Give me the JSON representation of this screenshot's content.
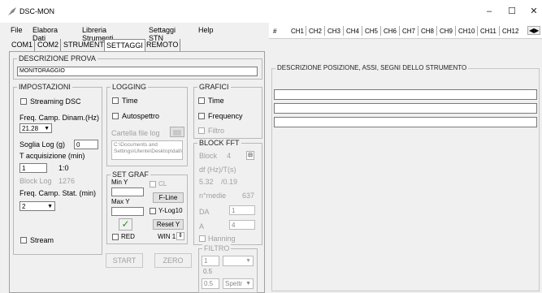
{
  "window": {
    "title": "DSC-MON",
    "minimize": "–",
    "maximize": "☐",
    "close": "✕"
  },
  "menu": [
    "File",
    "Elabora Dati",
    "Libreria Strumenti",
    "Settaggi STN",
    "Help"
  ],
  "tabs": [
    {
      "label": "COM1",
      "active": false
    },
    {
      "label": "COM2",
      "active": false
    },
    {
      "label": "STRUMENTI",
      "active": false
    },
    {
      "label": "SETTAGGI",
      "active": true
    },
    {
      "label": "REMOTO",
      "active": false
    }
  ],
  "descrizione": {
    "legend": "DESCRIZIONE PROVA",
    "value": "MONITORAGGIO"
  },
  "impostazioni": {
    "legend": "IMPOSTAZIONI",
    "streaming_dsc": "Streaming DSC",
    "freq_dinam_label": "Freq. Camp. Dinam.(Hz)",
    "freq_dinam_value": "21.28",
    "soglia_label": "Soglia Log (g)",
    "soglia_value": "0",
    "tacq_label": "T acquisizione (min)",
    "tacq_value": "1",
    "ratio": "1:0",
    "block_log_label": "Block Log",
    "block_log_value": "1276",
    "freq_stat_label": "Freq. Camp. Stat. (min)",
    "freq_stat_value": "2",
    "stream": "Stream"
  },
  "logging": {
    "legend": "LOGGING",
    "time": "Time",
    "autospettro": "Autospettro",
    "cartella_label": "Cartella file log",
    "path": "C:\\Documents and Settings\\Utente\\Desktop\\dati\\"
  },
  "set_graf": {
    "legend": "SET GRAF",
    "min_y": "Min Y",
    "max_y": "Max Y",
    "cl": "CL",
    "f_line": "F-Line",
    "y_log10": "Y-Log10",
    "check_icon": "✓",
    "reset_y": "Reset Y",
    "red": "RED",
    "win": "WIN 1"
  },
  "grafici": {
    "legend": "GRAFICI",
    "time": "Time",
    "frequency": "Frequency",
    "filtro": "Filtro"
  },
  "block_fft": {
    "legend": "BLOCK FFT",
    "block_label": "Block",
    "block_value": "4",
    "df_label": "df (Hz)/T(s)",
    "df_value": "5.32",
    "t_value": "/0.19",
    "nmedie_label": "n°medie",
    "nmedie_value": "637",
    "da_label": "DA",
    "da_value": "1",
    "a_label": "A",
    "a_value": "4",
    "hanning": "Hanning"
  },
  "filtro": {
    "legend": "FILTRO",
    "v1": "1",
    "v2": "0.5",
    "v3": "0.5",
    "sel_value": "Spettr"
  },
  "buttons": {
    "start": "START",
    "zero": "ZERO"
  },
  "right": {
    "channels": [
      "#",
      "CH1",
      "CH2",
      "CH3",
      "CH4",
      "CH5",
      "CH6",
      "CH7",
      "CH8",
      "CH9",
      "CH10",
      "CH11",
      "CH12"
    ],
    "arrows": "◀▶",
    "section_title": "DESCRIZIONE POSIZIONE, ASSI, SEGNI DELLO STRUMENTO"
  }
}
